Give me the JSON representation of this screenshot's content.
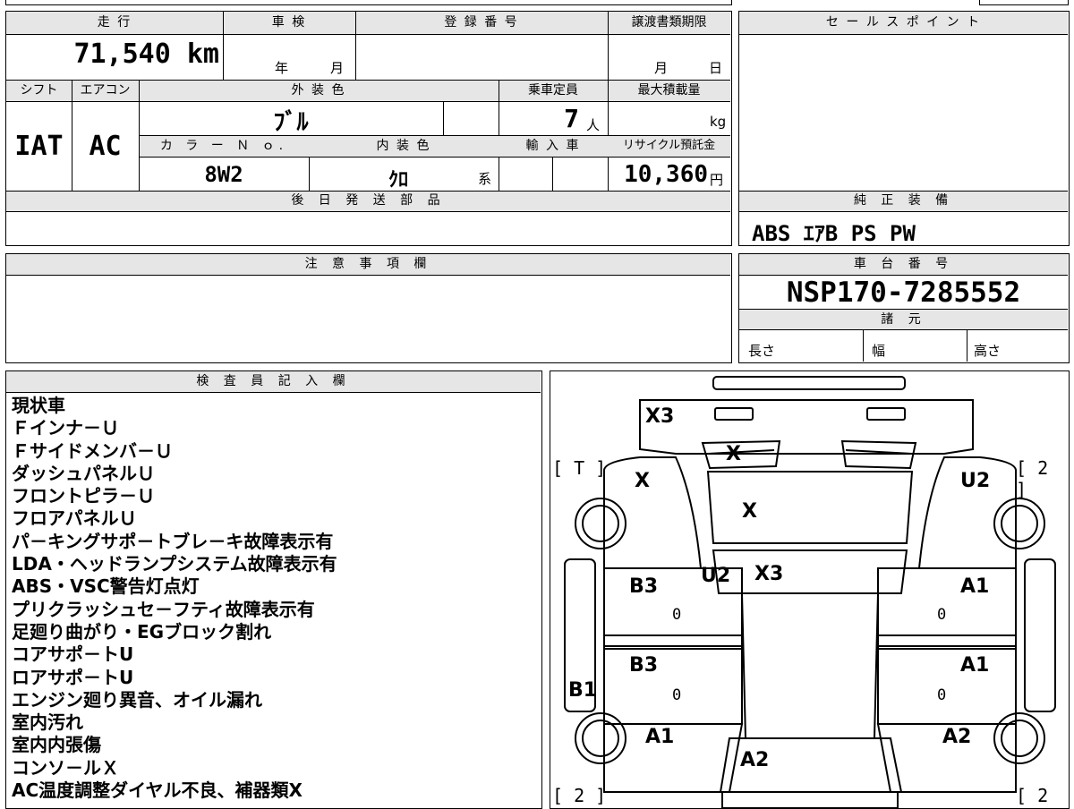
{
  "vehicle": {
    "mileage_label": "走 行",
    "mileage": "71,540 km",
    "inspection_label": "車 検",
    "inspection_year_unit": "年",
    "inspection_month_unit": "月",
    "registration_label": "登 録 番 号",
    "transfer_deadline_label": "譲渡書類期限",
    "transfer_month_unit": "月",
    "transfer_day_unit": "日",
    "shift_label": "シフト",
    "shift": "IAT",
    "ac_label": "エアコン",
    "ac": "AC",
    "exterior_color_label": "外 装 色",
    "exterior_color": "ﾌﾞﾙ",
    "capacity_label": "乗車定員",
    "capacity": "7",
    "capacity_unit": "人",
    "max_load_label": "最大積載量",
    "max_load_unit": "kg",
    "color_no_label": "カ ラ ー Ｎ ｏ.",
    "color_no": "8W2",
    "interior_color_label": "内 装 色",
    "interior_color": "ｸﾛ",
    "interior_color_unit": "系",
    "import_label": "輸 入 車",
    "recycle_label": "リサイクル預託金",
    "recycle_fee": "10,360",
    "recycle_unit": "円",
    "later_parts_label": "後 日 発 送 部 品",
    "notes_label": "注 意 事 項 欄"
  },
  "side": {
    "sales_point_label": "セ ー ル ス ポ イ ン ト",
    "equipment_label": "純 正 装 備",
    "equipment": "ABS ｴｱB PS PW",
    "chassis_label": "車 台 番 号",
    "chassis_no": "NSP170-7285552",
    "specs_label": "諸 元",
    "length_label": "長さ",
    "width_label": "幅",
    "height_label": "高さ"
  },
  "inspector": {
    "label": "検 査 員 記 入 欄",
    "lines": [
      "現状車",
      "Ｆインナ－Ｕ",
      "Ｆサイドメンバ－Ｕ",
      "ダッシュパネルＵ",
      "フロントピラ－Ｕ",
      "フロアパネルＵ",
      "パ－キングサポ－トブレ－キ故障表示有",
      "LDA・ヘッドランプシステム故障表示有",
      "ABS・VSC警告灯点灯",
      "プリクラッシュセ－フティ故障表示有",
      "足廻り曲がり・EGブロック割れ",
      "コアサポ－トU",
      "ロアサポ－トU",
      "エンジン廻り異音、オイル漏れ",
      "室内汚れ",
      "室内内張傷",
      "コンソ－ルＸ",
      "AC温度調整ダイヤル不良、補器類X"
    ]
  },
  "diagram": {
    "marks": {
      "front_bumper": "X3",
      "grille": "X",
      "front_left_fender": "X",
      "bonnet": "X",
      "front_right_fender": "U2",
      "cowl": "U2",
      "windshield": "X3",
      "left_front_door": "B3",
      "left_rear_door": "B3",
      "right_front_door": "A1",
      "right_rear_door": "A1",
      "left_sill": "B1",
      "left_quarter": "A1",
      "right_quarter": "A2",
      "rear_center": "A2",
      "zero": "0"
    },
    "tires": {
      "front_left": "[ T ]",
      "front_right": "[ 2 ]",
      "rear_left": "[ 2 ]",
      "rear_right": "[ 2 ]"
    }
  }
}
